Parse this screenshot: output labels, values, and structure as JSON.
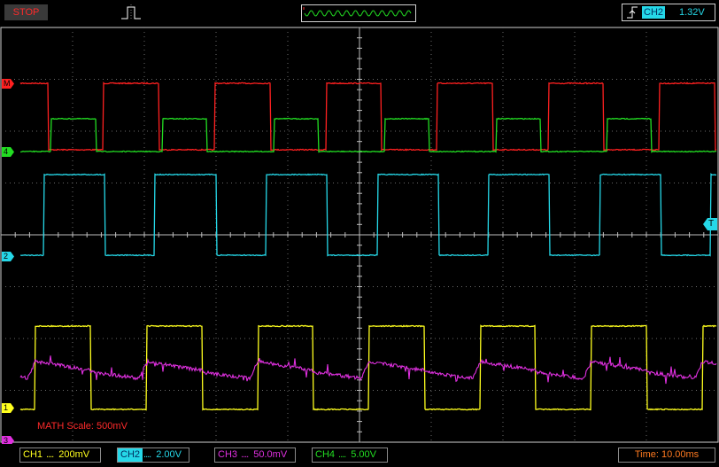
{
  "status": {
    "label": "STOP"
  },
  "trigger": {
    "channel": "CH2",
    "level": "1.32V",
    "color": "#25d8e8"
  },
  "markers": {
    "math": "M",
    "ch4": "4",
    "ch2": "2",
    "ch1": "1",
    "ch3": "3",
    "trigger": "T"
  },
  "math_scale": {
    "label": "MATH Scale:",
    "value": "500mV"
  },
  "channels": [
    {
      "name": "CH1",
      "coupling": "....",
      "scale": "200mV",
      "color": "#ffff1e"
    },
    {
      "name": "CH2",
      "coupling": "....",
      "scale": "2.00V",
      "color": "#25d8e8"
    },
    {
      "name": "CH3",
      "coupling": "....",
      "scale": "50.0mV",
      "color": "#e030e0"
    },
    {
      "name": "CH4",
      "coupling": "....",
      "scale": "5.00V",
      "color": "#22dd22"
    }
  ],
  "timebase": {
    "label": "Time:",
    "value": "10.00ms"
  },
  "waveforms": {
    "math": {
      "color": "#ff2020",
      "period_divisions": 1.55,
      "duty": 0.5
    },
    "ch4": {
      "color": "#22dd22",
      "period_divisions": 1.55,
      "duty": 0.4
    },
    "ch2": {
      "color": "#25d8e8",
      "period_divisions": 1.55,
      "duty": 0.55
    },
    "ch1": {
      "color": "#ffff1e",
      "period_divisions": 1.55,
      "duty": 0.5
    },
    "ch3": {
      "color": "#e030e0",
      "period_divisions": 1.55
    }
  }
}
